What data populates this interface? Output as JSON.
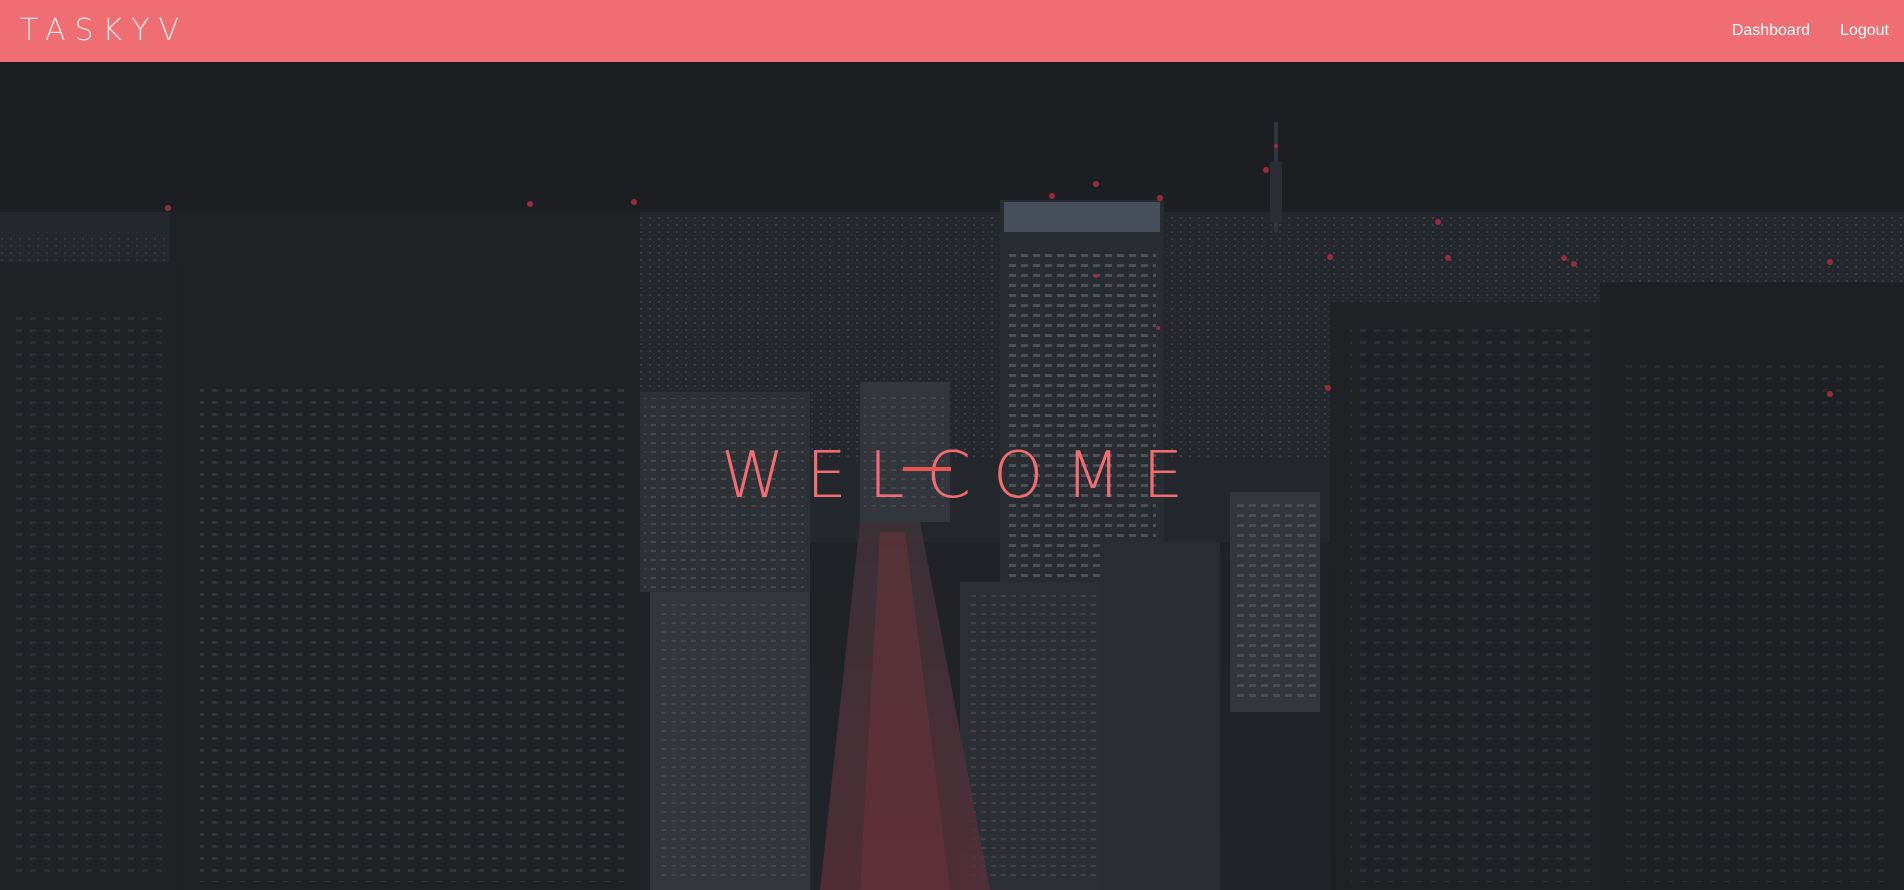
{
  "navbar": {
    "brand": "TASKYV",
    "links": [
      {
        "label": "Dashboard"
      },
      {
        "label": "Logout"
      }
    ]
  },
  "hero": {
    "title": "WELCOME",
    "background": "night-city-skyline-photo"
  },
  "colors": {
    "navbar_bg": "#ee6e73",
    "accent": "#ee6e73",
    "overlay": "#1e2124"
  }
}
